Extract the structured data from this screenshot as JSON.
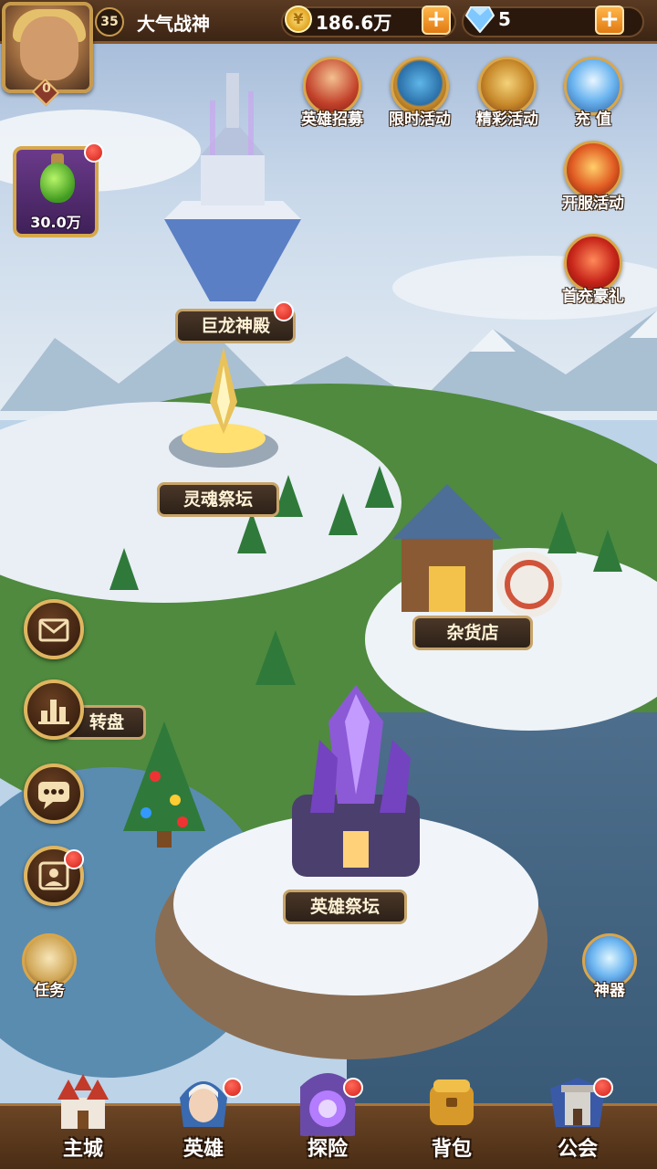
{
  "player": {
    "level": "35",
    "name": "大气战神",
    "vip": "0"
  },
  "resources": {
    "gold": "186.6万",
    "gems": "5",
    "gold_icon": "coin-icon",
    "gem_icon": "diamond-icon"
  },
  "potion": {
    "value": "30.0万",
    "icon": "green-potion-icon"
  },
  "activities": [
    {
      "label": "英雄招募",
      "icon": "hero-recruit-icon"
    },
    {
      "label": "限时活动",
      "icon": "compass-icon"
    },
    {
      "label": "精彩活动",
      "icon": "scroll-icon"
    },
    {
      "label": "充 值",
      "icon": "diamond-icon"
    },
    {
      "label": "开服活动",
      "icon": "chest-icon"
    },
    {
      "label": "首充豪礼",
      "icon": "gift-bag-icon"
    }
  ],
  "buildings": {
    "dragon_temple": "巨龙神殿",
    "soul_altar": "灵魂祭坛",
    "shop": "杂货店",
    "wheel": "转盘",
    "hero_altar": "英雄祭坛"
  },
  "side": {
    "quest": "任务",
    "artifact": "神器"
  },
  "nav": [
    {
      "label": "主城",
      "icon": "castle-icon"
    },
    {
      "label": "英雄",
      "icon": "hero-portrait-icon"
    },
    {
      "label": "探险",
      "icon": "portal-icon"
    },
    {
      "label": "背包",
      "icon": "backpack-icon"
    },
    {
      "label": "公会",
      "icon": "guild-tower-icon"
    }
  ],
  "colors": {
    "accent_gold": "#d9a64a",
    "notification_red": "#d4201a",
    "panel_brown": "#4a2d15"
  }
}
